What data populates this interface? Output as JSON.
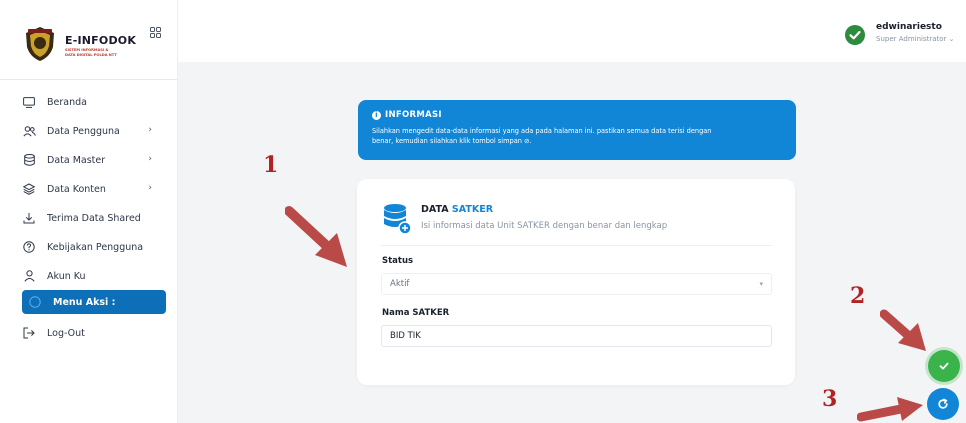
{
  "brand": {
    "title": "E-INFODOK",
    "subtitle_1": "SISTEM INFORMASI &",
    "subtitle_2": "DATA DIGITAL POLDA NTT"
  },
  "user": {
    "name": "edwinariesto",
    "role": "Super Administrator ⌄"
  },
  "menu": {
    "items": [
      {
        "label": "Beranda",
        "icon": "monitor-icon",
        "chevron": ""
      },
      {
        "label": "Data Pengguna",
        "icon": "users-icon",
        "chevron": "›"
      },
      {
        "label": "Data Master",
        "icon": "database-icon",
        "chevron": "›"
      },
      {
        "label": "Data Konten",
        "icon": "layers-icon",
        "chevron": "›"
      },
      {
        "label": "Terima Data Shared",
        "icon": "download-icon",
        "chevron": ""
      },
      {
        "label": "Kebijakan Pengguna",
        "icon": "help-circle-icon",
        "chevron": ""
      },
      {
        "label": "Akun Ku",
        "icon": "user-icon",
        "chevron": ""
      },
      {
        "label": "Menu Aksi :",
        "icon": "info-circle-icon",
        "chevron": "",
        "active": true
      },
      {
        "label": "Log-Out",
        "icon": "logout-icon",
        "chevron": ""
      }
    ]
  },
  "info": {
    "title": "INFORMASI",
    "text_line1": "Silahkan mengedit data-data informasi yang ada pada halaman ini. pastikan semua data terisi dengan",
    "text_line2": "benar, kemudian silahkan klik tombol simpan ⊘."
  },
  "form": {
    "title_prefix": "DATA ",
    "title_accent": "SATKER",
    "subtitle": "Isi informasi data Unit SATKER dengan benar dan lengkap",
    "status_label": "Status",
    "status_value": "Aktif",
    "nama_label": "Nama SATKER",
    "nama_value": "BID TIK"
  },
  "annotations": {
    "n1": "1",
    "n2": "2",
    "n3": "3"
  },
  "colors": {
    "primary": "#1286d6",
    "active_menu": "#0d6fb8",
    "success": "#3ab34a",
    "annotation": "#b22222"
  }
}
